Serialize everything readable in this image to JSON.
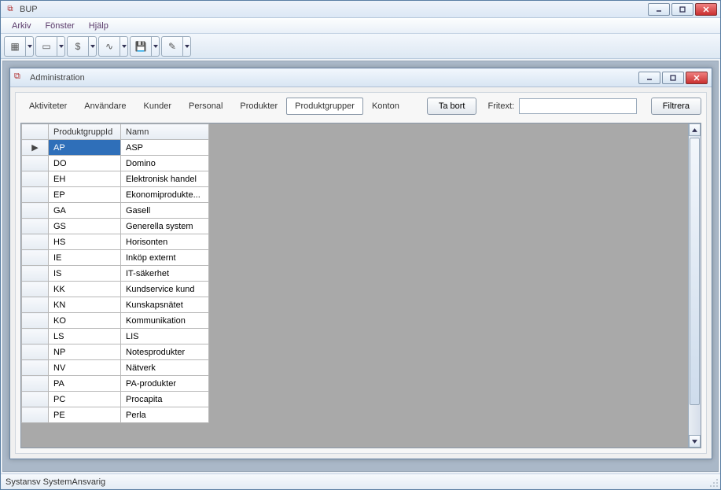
{
  "app": {
    "title": "BUP"
  },
  "menu": {
    "items": [
      "Arkiv",
      "Fönster",
      "Hjälp"
    ]
  },
  "toolbar": {
    "buttons": [
      {
        "name": "grid-icon"
      },
      {
        "name": "document-icon"
      },
      {
        "name": "currency-icon"
      },
      {
        "name": "chart-icon"
      },
      {
        "name": "save-icon"
      },
      {
        "name": "tools-icon"
      }
    ]
  },
  "child": {
    "title": "Administration",
    "tabs": [
      {
        "label": "Aktiviteter",
        "active": false
      },
      {
        "label": "Användare",
        "active": false
      },
      {
        "label": "Kunder",
        "active": false
      },
      {
        "label": "Personal",
        "active": false
      },
      {
        "label": "Produkter",
        "active": false
      },
      {
        "label": "Produktgrupper",
        "active": true
      },
      {
        "label": "Konton",
        "active": false
      }
    ],
    "delete_label": "Ta bort",
    "freetext_label": "Fritext:",
    "freetext_value": "",
    "filter_label": "Filtrera",
    "columns": {
      "id": "ProduktgruppId",
      "name": "Namn"
    },
    "rows": [
      {
        "id": "AP",
        "name": "ASP",
        "selected": true,
        "current": true
      },
      {
        "id": "DO",
        "name": "Domino"
      },
      {
        "id": "EH",
        "name": "Elektronisk handel"
      },
      {
        "id": "EP",
        "name": "Ekonomiprodukte..."
      },
      {
        "id": "GA",
        "name": "Gasell"
      },
      {
        "id": "GS",
        "name": "Generella system"
      },
      {
        "id": "HS",
        "name": "Horisonten"
      },
      {
        "id": "IE",
        "name": "Inköp externt"
      },
      {
        "id": "IS",
        "name": "IT-säkerhet"
      },
      {
        "id": "KK",
        "name": "Kundservice kund"
      },
      {
        "id": "KN",
        "name": "Kunskapsnätet"
      },
      {
        "id": "KO",
        "name": "Kommunikation"
      },
      {
        "id": "LS",
        "name": "LIS"
      },
      {
        "id": "NP",
        "name": "Notesprodukter"
      },
      {
        "id": "NV",
        "name": "Nätverk"
      },
      {
        "id": "PA",
        "name": "PA-produkter"
      },
      {
        "id": "PC",
        "name": "Procapita"
      },
      {
        "id": "PE",
        "name": "Perla"
      }
    ]
  },
  "status": {
    "text": "Systansv SystemAnsvarig"
  }
}
